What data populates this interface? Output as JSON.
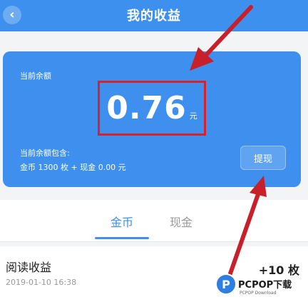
{
  "header": {
    "back_icon": "chevron-left-icon",
    "back_glyph": "‹",
    "title": "我的收益"
  },
  "balance_card": {
    "label": "当前余额",
    "amount": "0.76",
    "unit": "元",
    "includes_label": "当前余额包含:",
    "breakdown": "金币 1300 枚 + 现金 0.00 元",
    "withdraw_label": "提现"
  },
  "tabs": [
    {
      "label": "金币",
      "active": true
    },
    {
      "label": "现金",
      "active": false
    }
  ],
  "records": [
    {
      "title": "阅读收益",
      "date": "2019-01-10 16:38",
      "amount": "+10 枚"
    }
  ],
  "watermark": {
    "text": "PCPOP下载",
    "subtext": "PCPOP Download",
    "icon_glyph": "P"
  },
  "colors": {
    "primary": "#3e8fee",
    "highlight": "#d6232b",
    "arrow": "#c8202a"
  }
}
